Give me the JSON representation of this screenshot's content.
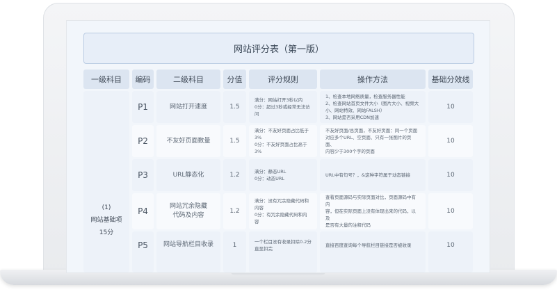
{
  "title": "网站评分表（第一版）",
  "headers": [
    "一级科目",
    "编码",
    "二级科目",
    "分值",
    "评分规则",
    "操作方法",
    "基础分效线"
  ],
  "level1": {
    "index": "(1)",
    "name": "网站基础项",
    "score": "15分"
  },
  "rows": [
    {
      "code": "P1",
      "name": "网站打开速度",
      "score": "1.5",
      "rule": "满分：网站打开3秒以内\n0分：超过3秒或经常无法访问",
      "method": "1、检查本地网络质量，检查服务器性能\n2、检查网站首页文件大小（图片大小、视频大\n小、网站特效、网站FALSH）\n3、网站是否采用CDN加速",
      "basic": "10"
    },
    {
      "code": "P2",
      "name": "不友好页面数量",
      "score": "1.5",
      "rule": "满分：不友好页面占比低于3%\n0分：不友好页面占比高于3%",
      "method": "不友好页面/总页面，不友好页面：同一个页面\n对应多个URL、空页面、只有一张图片的页面、\n内容少于300个字的页面",
      "basic": "10"
    },
    {
      "code": "P3",
      "name": "URL静态化",
      "score": "1.2",
      "rule": "满分：静态URL\n0分：动态URL",
      "method": "URL中有句号？，&这种字符属于动态链接",
      "basic": "10"
    },
    {
      "code": "P4",
      "name": "网站冗余隐藏\n代码及内容",
      "score": "1.2",
      "rule": "满分：没有冗余隐藏代码和内容\n0分：有冗余隐藏代码和内容",
      "method": "查看页面源码与实际页面对比，页面源码中有内\n容，但在实际页面上没有体现出来的代码，以及\n是否有大量的注释代码",
      "basic": "10"
    },
    {
      "code": "P5",
      "name": "网站导航栏目收录",
      "score": "1",
      "rule": "一个栏目没有收录扣除0.2分\n直至扣完",
      "method": "直接百度查询每个导航栏目链接是否被收录",
      "basic": "10"
    }
  ]
}
